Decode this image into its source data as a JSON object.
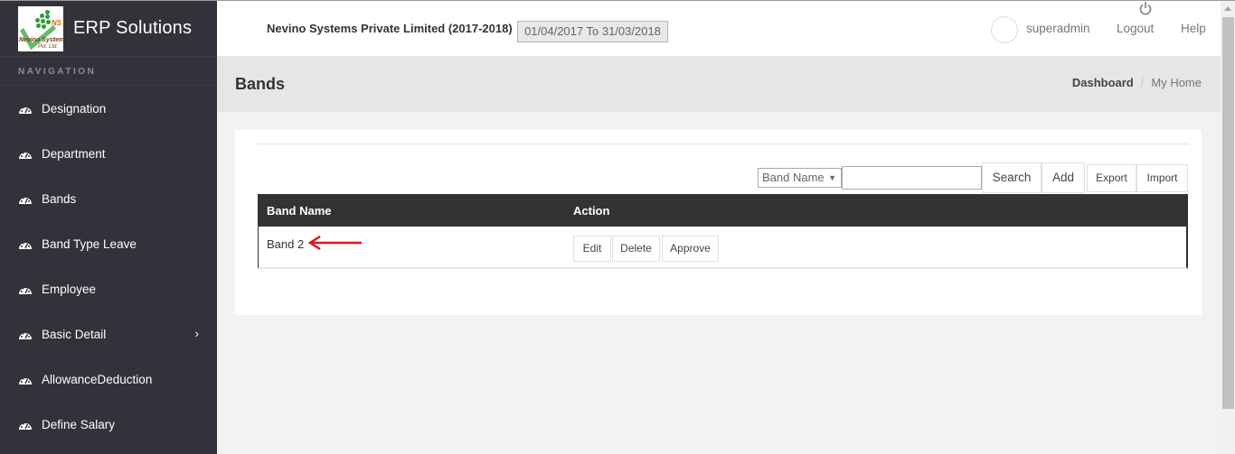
{
  "app": {
    "title": "ERP Solutions",
    "logo_text": {
      "mark": "NS",
      "line1": "Nevino Systems",
      "line2": "Pvt. Ltd."
    }
  },
  "sidebar": {
    "header": "NAVIGATION",
    "icon": "dashboard-gauge-icon",
    "items": [
      {
        "label": "Designation"
      },
      {
        "label": "Department"
      },
      {
        "label": "Bands"
      },
      {
        "label": "Band Type Leave"
      },
      {
        "label": "Employee"
      },
      {
        "label": "Basic Detail",
        "has_children": true
      },
      {
        "label": "AllowanceDeduction"
      },
      {
        "label": "Define Salary"
      }
    ]
  },
  "topbar": {
    "company": "Nevino Systems Private Limited (2017-2018)",
    "financial_year": "01/04/2017 To 31/03/2018",
    "username": "superadmin",
    "logout": "Logout",
    "help": "Help"
  },
  "page": {
    "title": "Bands",
    "breadcrumb": [
      "Dashboard",
      "My Home"
    ]
  },
  "toolbar": {
    "filter_field": "Band Name",
    "search_value": "",
    "search": "Search",
    "add": "Add",
    "export": "Export",
    "import": "Import"
  },
  "table": {
    "columns": [
      "Band Name",
      "Action"
    ],
    "rows": [
      {
        "band_name": "Band 2",
        "actions": [
          "Edit",
          "Delete",
          "Approve"
        ]
      }
    ]
  },
  "annotation": {
    "type": "red-arrow",
    "color": "#e0141e",
    "points_to": "Band 2"
  }
}
